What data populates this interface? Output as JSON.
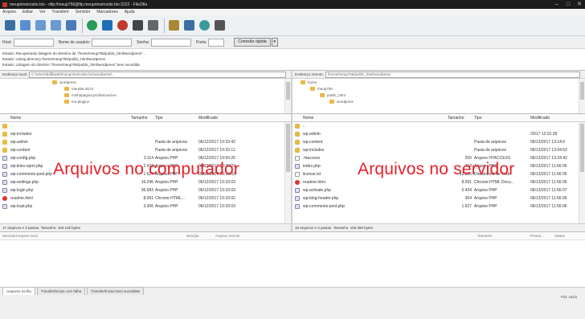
{
  "window": {
    "title": "meuprimeirosite.bio - sftp://meup756@ftp.meuprimeirosite.bio:2222 - FileZilla"
  },
  "menu": [
    "Arquivo",
    "Editar",
    "Ver",
    "Transferir",
    "Servidor",
    "Marcadores",
    "Ajuda"
  ],
  "toolbar": [
    "site-manager-icon",
    "toggle-log-icon",
    "toggle-local-tree-icon",
    "toggle-remote-tree-icon",
    "toggle-queue-icon",
    "refresh-icon",
    "process-queue-icon",
    "cancel-icon",
    "disconnect-icon",
    "reconnect-icon",
    "filter-icon",
    "compare-icon",
    "sync-browse-icon",
    "search-icon"
  ],
  "quickconnect": {
    "host_label": "Host:",
    "user_label": "Nome de usuário:",
    "password_label": "Senha:",
    "port_label": "Porta:",
    "button": "Conexão rápida",
    "dropdown": "▾"
  },
  "log": [
    "Estado:   Recuperando listagem do diretório de \"/home/meup756/public_html/wordpress\"...",
    "Estado:   Listing directory /home/meup756/public_html/wordpress",
    "Estado:   Listagem do diretório \"/home/meup756/public_html/wordpress\" bem sucedida"
  ],
  "local": {
    "path_label": "Endereço local:",
    "path": "C:\\Users\\bdlb\\web\\meuprimeirosite.bio\\wordpress\\",
    "tree": [
      "wordpress",
      "meusite.ab.br",
      "minhapagina.profissional.es",
      "mu-plugins"
    ],
    "columns": {
      "name": "Nome",
      "size": "Tamanho",
      "type": "Tipo",
      "modified": "Modificado"
    },
    "rows": [
      {
        "name": "..",
        "size": "",
        "type": "",
        "modified": "",
        "icon": "folder"
      },
      {
        "name": "wp-includes",
        "size": "",
        "type": "",
        "modified": "",
        "icon": "folder"
      },
      {
        "name": "wp-admin",
        "size": "",
        "type": "Pasta de arquivos",
        "modified": "06/12/2017 10:33:42",
        "icon": "folder"
      },
      {
        "name": "wp-content",
        "size": "",
        "type": "Pasta de arquivos",
        "modified": "06/12/2017 10:33:11",
        "icon": "folder"
      },
      {
        "name": "wp-config.php",
        "size": "3.114",
        "type": "Arquivo PHP",
        "modified": "06/12/2017 10:50:26",
        "icon": "php"
      },
      {
        "name": "wp-links-opml.php",
        "size": "2.422",
        "type": "Arquivo PHP",
        "modified": "06/12/2017 10:33:03",
        "icon": "php"
      },
      {
        "name": "wp-comments-post.php",
        "size": "1.627",
        "type": "Arquivo PHP",
        "modified": "06/12/2017 10:33:02",
        "icon": "php"
      },
      {
        "name": "wp-settings.php",
        "size": "16.246",
        "type": "Arquivo PHP",
        "modified": "06/12/2017 10:33:03",
        "icon": "php"
      },
      {
        "name": "wp-login.php",
        "size": "36.583",
        "type": "Arquivo PHP",
        "modified": "06/12/2017 10:33:03",
        "icon": "php"
      },
      {
        "name": "readme.html",
        "size": "8.091",
        "type": "Chrome HTML...",
        "modified": "06/12/2017 10:33:02",
        "icon": "html"
      },
      {
        "name": "wp-load.php",
        "size": "3.306",
        "type": "Arquivo PHP",
        "modified": "06/12/2017 10:33:03",
        "icon": "php"
      }
    ],
    "overlay": "Arquivos no computador",
    "status": "17 arquivos e 3 pastas. Tamanho: 150.135 bytes"
  },
  "remote": {
    "path_label": "Endereço remoto:",
    "path": "/home/meup756/public_html/wordpress",
    "tree": [
      "home",
      "meup756",
      "public_html",
      "wordpress"
    ],
    "columns": {
      "name": "Nome",
      "size": "Tamanho",
      "type": "Tipo",
      "modified": "Modificado"
    },
    "rows": [
      {
        "name": "..",
        "size": "",
        "type": "",
        "modified": "",
        "icon": "folder"
      },
      {
        "name": "wp-admin",
        "size": "",
        "type": "",
        "modified": "/2017 12:01:39",
        "icon": "folder"
      },
      {
        "name": "wp-content",
        "size": "",
        "type": "Pasta de arquivos",
        "modified": "06/12/2017 13:14:0",
        "icon": "folder"
      },
      {
        "name": "wp-includes",
        "size": "",
        "type": "Pasta de arquivos",
        "modified": "06/12/2017 12:04:52",
        "icon": "folder"
      },
      {
        "name": ".htaccess",
        "size": "255",
        "type": "Arquivo HTACCESS",
        "modified": "06/12/2017 13:24:42",
        "icon": "file"
      },
      {
        "name": "index.php",
        "size": "418",
        "type": "Arquivo PHP",
        "modified": "06/12/2017 11:56:05",
        "icon": "php"
      },
      {
        "name": "license.txt",
        "size": "19.935",
        "type": "Documento de Texto",
        "modified": "06/12/2017 11:56:05",
        "icon": "file"
      },
      {
        "name": "readme.html",
        "size": "8.091",
        "type": "Chrome HTML Docu...",
        "modified": "06/12/2017 11:56:05",
        "icon": "html"
      },
      {
        "name": "wp-activate.php",
        "size": "5.434",
        "type": "Arquivo PHP",
        "modified": "06/12/2017 11:56:07",
        "icon": "php"
      },
      {
        "name": "wp-blog-header.php",
        "size": "364",
        "type": "Arquivo PHP",
        "modified": "06/12/2017 11:56:05",
        "icon": "php"
      },
      {
        "name": "wp-comments-post.php",
        "size": "1.627",
        "type": "Arquivo PHP",
        "modified": "06/12/2017 11:56:06",
        "icon": "php"
      }
    ],
    "overlay": "Arquivos no servidor",
    "status": "18 arquivos e 3 pastas. Tamanho: 150.390 bytes"
  },
  "queue": {
    "columns": [
      "Servidor/Arquivo local",
      "Direção",
      "Arquivo remoto",
      "Tamanho",
      "Priorid...",
      "Status"
    ],
    "tabs": [
      "Arquivos na fila",
      "Transferências com falha",
      "Transferências bem sucedidas"
    ],
    "status": "Fila: vazia"
  }
}
